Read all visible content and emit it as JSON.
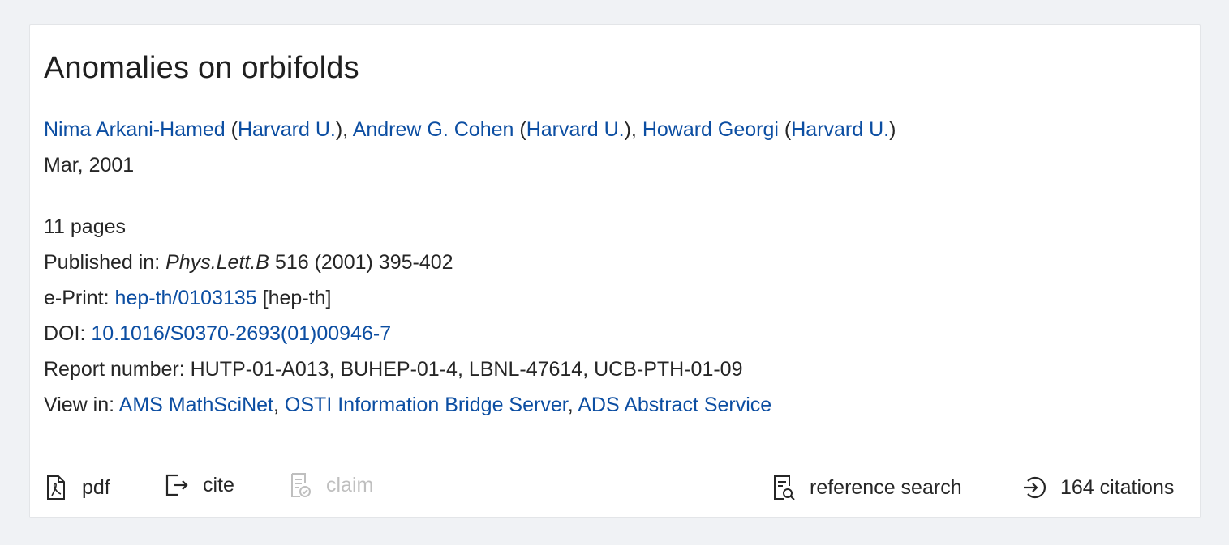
{
  "record": {
    "title": "Anomalies on orbifolds",
    "authors": [
      {
        "name": "Nima Arkani-Hamed",
        "affiliation": "Harvard U."
      },
      {
        "name": "Andrew G. Cohen",
        "affiliation": "Harvard U."
      },
      {
        "name": "Howard Georgi",
        "affiliation": "Harvard U."
      }
    ],
    "date": "Mar, 2001",
    "pages": "11 pages",
    "published_label": "Published in:",
    "journal": "Phys.Lett.B",
    "journal_ref": "516 (2001) 395-402",
    "eprint_label": "e-Print:",
    "eprint": "hep-th/0103135",
    "eprint_category": "[hep-th]",
    "doi_label": "DOI:",
    "doi": "10.1016/S0370-2693(01)00946-7",
    "report_label": "Report number:",
    "report_numbers": "HUTP-01-A013, BUHEP-01-4, LBNL-47614, UCB-PTH-01-09",
    "view_label": "View in:",
    "view_links": [
      "AMS MathSciNet",
      "OSTI Information Bridge Server",
      "ADS Abstract Service"
    ]
  },
  "actions": {
    "pdf": {
      "label": "pdf",
      "icon": "file-pdf-icon"
    },
    "cite": {
      "label": "cite",
      "icon": "export-icon"
    },
    "claim": {
      "label": "claim",
      "icon": "file-done-icon",
      "disabled": true
    },
    "reference_search": {
      "label": "reference search",
      "icon": "file-search-icon"
    },
    "citations": {
      "label": "164 citations",
      "icon": "login-icon"
    }
  },
  "colors": {
    "link": "#0c4ea2",
    "text": "#262626",
    "disabled": "#bfbfbf",
    "background": "#f0f2f5"
  }
}
